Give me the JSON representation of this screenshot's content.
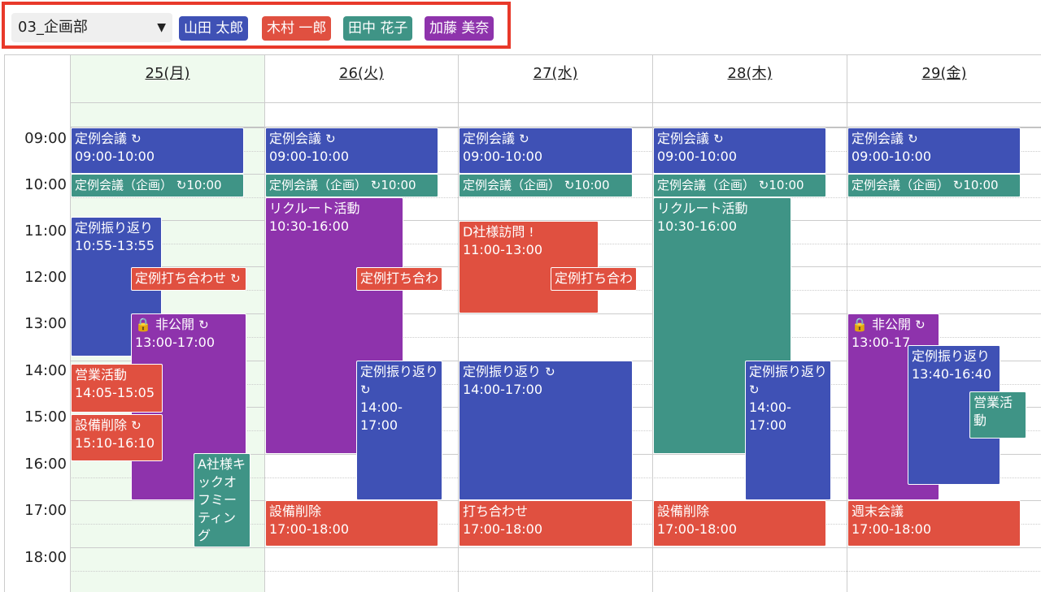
{
  "toolbar": {
    "department": "03_企画部",
    "members": [
      {
        "name": "山田 太郎",
        "color": "#3f51b5"
      },
      {
        "name": "木村 一郎",
        "color": "#e05040"
      },
      {
        "name": "田中 花子",
        "color": "#3f9486"
      },
      {
        "name": "加藤 美奈",
        "color": "#8e33ac"
      }
    ]
  },
  "days": [
    "25(月)",
    "26(火)",
    "27(水)",
    "28(木)",
    "29(金)"
  ],
  "times": [
    "09:00",
    "10:00",
    "11:00",
    "12:00",
    "13:00",
    "14:00",
    "15:00",
    "16:00",
    "17:00",
    "18:00"
  ],
  "events": {
    "mon": [
      {
        "title": "定例会議",
        "time": "09:00-10:00",
        "icon": "↻"
      },
      {
        "title": "定例会議（企画）",
        "time": "10:00",
        "icon": "↻"
      },
      {
        "title": "定例振り返り",
        "time": "10:55-13:55"
      },
      {
        "title": "定例打ち合わせ",
        "icon": "↻"
      },
      {
        "title": "非公開",
        "time": "13:00-17:00",
        "lock": "🔒",
        "icon": "↻"
      },
      {
        "title": "営業活動",
        "time": "14:05-15:05"
      },
      {
        "title": "設備削除",
        "time": "15:10-16:10",
        "icon": "↻"
      },
      {
        "title": "A社様キックオフミーティング"
      }
    ],
    "tue": [
      {
        "title": "定例会議",
        "time": "09:00-10:00",
        "icon": "↻"
      },
      {
        "title": "定例会議（企画）",
        "time": "10:00",
        "icon": "↻"
      },
      {
        "title": "リクルート活動",
        "time": "10:30-16:00"
      },
      {
        "title": "定例打ち合わ"
      },
      {
        "title": "定例振り返り",
        "time": "14:00-17:00",
        "icon": "↻"
      },
      {
        "title": "設備削除",
        "time": "17:00-18:00"
      }
    ],
    "wed": [
      {
        "title": "定例会議",
        "time": "09:00-10:00",
        "icon": "↻"
      },
      {
        "title": "定例会議（企画）",
        "time": "10:00",
        "icon": "↻"
      },
      {
        "title": "D社様訪問",
        "time": "11:00-13:00",
        "icon": "!"
      },
      {
        "title": "定例打ち合わ"
      },
      {
        "title": "定例振り返り",
        "time": "14:00-17:00",
        "icon": "↻"
      },
      {
        "title": "打ち合わせ",
        "time": "17:00-18:00"
      }
    ],
    "thu": [
      {
        "title": "定例会議",
        "time": "09:00-10:00",
        "icon": "↻"
      },
      {
        "title": "定例会議（企画）",
        "time": "10:00",
        "icon": "↻"
      },
      {
        "title": "リクルート活動",
        "time": "10:30-16:00"
      },
      {
        "title": "定例振り返り",
        "time": "14:00-17:00",
        "icon": "↻"
      },
      {
        "title": "設備削除",
        "time": "17:00-18:00"
      }
    ],
    "fri": [
      {
        "title": "定例会議",
        "time": "09:00-10:00",
        "icon": "↻"
      },
      {
        "title": "定例会議（企画）",
        "time": "10:00",
        "icon": "↻"
      },
      {
        "title": "非公開",
        "time": "13:00-17",
        "lock": "🔒",
        "icon": "↻"
      },
      {
        "title": "定例振り返り",
        "time": "13:40-16:40"
      },
      {
        "title": "営業活動"
      },
      {
        "title": "週末会議",
        "time": "17:00-18:00"
      }
    ]
  }
}
